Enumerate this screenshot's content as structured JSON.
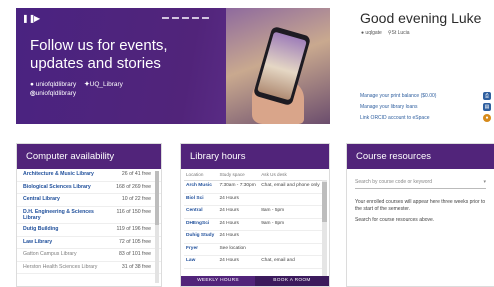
{
  "hero": {
    "title": "Follow us for events, updates and stories",
    "social": {
      "facebook": "uniofqldlibrary",
      "twitter": "UQ_Library",
      "instagram": "uniofqldlibrary"
    }
  },
  "greeting": {
    "text": "Good evening Luke",
    "user_id": "uqlgate",
    "location": "St Lucia"
  },
  "account_links": [
    {
      "label": "Manage your print balance ($0.00)",
      "icon": "printer-icon"
    },
    {
      "label": "Manage your library loans",
      "icon": "books-icon"
    },
    {
      "label": "Link ORCID account to eSpace",
      "icon": "orcid-icon"
    }
  ],
  "computers": {
    "title": "Computer availability",
    "rows": [
      {
        "name": "Architecture & Music Library",
        "count": "26 of 41 free",
        "muted": false
      },
      {
        "name": "Biological Sciences Library",
        "count": "168 of 269 free",
        "muted": false
      },
      {
        "name": "Central Library",
        "count": "10 of 22 free",
        "muted": false
      },
      {
        "name": "D.H. Engineering & Sciences Library",
        "count": "116 of 150 free",
        "muted": false
      },
      {
        "name": "Dutig Building",
        "count": "119 of 196 free",
        "muted": false
      },
      {
        "name": "Law Library",
        "count": "72 of 105 free",
        "muted": false
      },
      {
        "name": "Gatton Campus Library",
        "count": "83 of 101 free",
        "muted": true
      },
      {
        "name": "Herston Health Sciences Library",
        "count": "31 of 38 free",
        "muted": true
      }
    ]
  },
  "hours": {
    "title": "Library hours",
    "headers": [
      "Location",
      "Study space",
      "Ask Us desk"
    ],
    "rows": [
      {
        "location": "Arch Music",
        "study": "7:30am - 7:30pm",
        "ask": "Chat, email and phone only"
      },
      {
        "location": "Biol Sci",
        "study": "24 Hours",
        "ask": ""
      },
      {
        "location": "Central",
        "study": "24 Hours",
        "ask": "8am - 5pm"
      },
      {
        "location": "DHEngSci",
        "study": "24 Hours",
        "ask": "9am - 8pm"
      },
      {
        "location": "Duhig Study",
        "study": "24 Hours",
        "ask": ""
      },
      {
        "location": "Fryer",
        "study": "See location",
        "ask": ""
      },
      {
        "location": "Law",
        "study": "24 Hours",
        "ask": "Chat, email and"
      }
    ],
    "weekly_label": "WEEKLY HOURS",
    "book_label": "BOOK A ROOM"
  },
  "resources": {
    "title": "Course resources",
    "search_placeholder": "Search by course code or keyword",
    "text1": "Your enrolled courses will appear here three weeks prior to the start of the semester.",
    "text2": "Search for course resources above."
  },
  "colors": {
    "brand_purple": "#51247a",
    "link_blue": "#1f4f9b"
  }
}
